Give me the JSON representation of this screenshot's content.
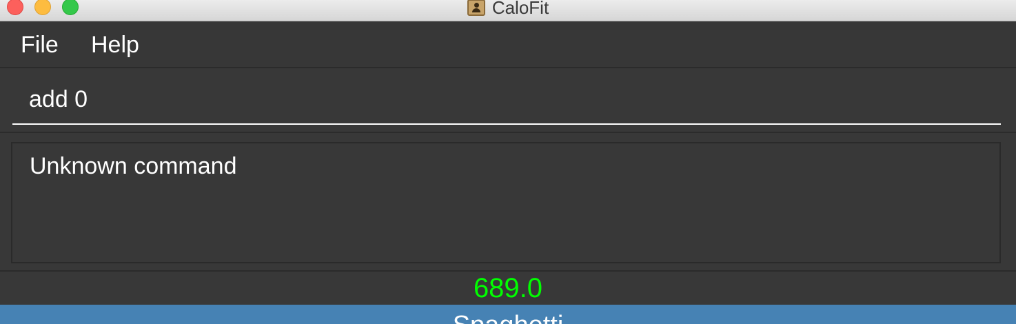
{
  "window": {
    "title": "CaloFit",
    "icon": "contact-card-icon"
  },
  "menubar": {
    "items": [
      {
        "label": "File"
      },
      {
        "label": "Help"
      }
    ]
  },
  "command_box": {
    "value": "add 0"
  },
  "result_display": {
    "text": "Unknown command"
  },
  "calorie_display": {
    "value": "689.0",
    "color": "#00ff00"
  },
  "meal_list": {
    "items": [
      {
        "name": "Spaghetti"
      }
    ],
    "highlight_color": "#4682b4"
  }
}
